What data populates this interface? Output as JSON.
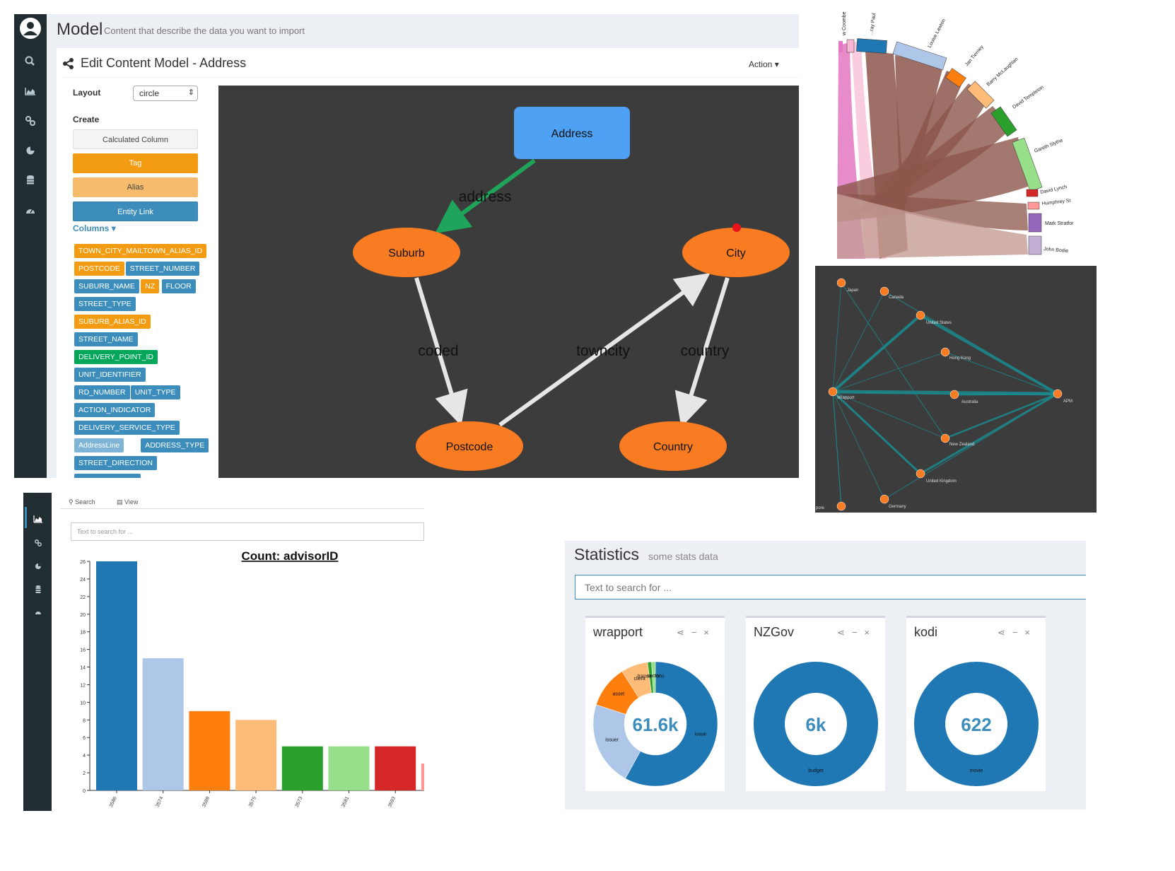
{
  "model_panel": {
    "title": "Model",
    "subtitle": "Content that describe the data you want to import",
    "box_title": "Edit Content Model - Address",
    "action_label": "Action",
    "layout_label": "Layout",
    "layout_value": "circle",
    "create_label": "Create",
    "buttons": {
      "calculated": "Calculated Column",
      "tag": "Tag",
      "alias": "Alias",
      "entity_link": "Entity Link"
    },
    "columns_label": "Columns",
    "columns": [
      {
        "label": "TOWN_CITY_MAILTOWN_ALIAS_ID",
        "color": "orange"
      },
      {
        "label": "POSTCODE",
        "color": "orange"
      },
      {
        "label": "STREET_NUMBER",
        "color": "blue"
      },
      {
        "label": "SUBURB_NAME",
        "color": "blue"
      },
      {
        "label": "NZ",
        "color": "orange"
      },
      {
        "label": "FLOOR",
        "color": "blue"
      },
      {
        "label": "STREET_TYPE",
        "color": "blue"
      },
      {
        "label": "SUBURB_ALIAS_ID",
        "color": "orange"
      },
      {
        "label": "STREET_NAME",
        "color": "blue"
      },
      {
        "label": "DELIVERY_POINT_ID",
        "color": "green"
      },
      {
        "label": "UNIT_IDENTIFIER",
        "color": "blue"
      },
      {
        "label": "RD_NUMBER",
        "color": "blue"
      },
      {
        "label": "UNIT_TYPE",
        "color": "blue"
      },
      {
        "label": "ACTION_INDICATOR",
        "color": "blue"
      },
      {
        "label": "DELIVERY_SERVICE_TYPE",
        "color": "blue"
      },
      {
        "label": "AddressLine",
        "color": "light"
      },
      {
        "label": "ADDRESS_TYPE",
        "color": "blue"
      },
      {
        "label": "STREET_DIRECTION",
        "color": "blue"
      }
    ],
    "graph": {
      "nodes": {
        "address": "Address",
        "suburb": "Suburb",
        "city": "City",
        "postcode": "Postcode",
        "country": "Country"
      },
      "edges": {
        "address": "address",
        "coded": "coded",
        "towncity": "towncity",
        "country": "country"
      }
    },
    "colors": {
      "sidebar": "#222d32",
      "node_orange": "#f97c22",
      "node_blue": "#4ea1f3",
      "edge_green": "#1fa55b"
    }
  },
  "chord_panel": {
    "labels": [
      "w Coombe",
      "...ray Paul",
      "Louise Lawton",
      "Jan Tierney",
      "Barry McLaughlan",
      "David Templeton",
      "Gareth Slythe",
      "David Lynch",
      "Humphrey St",
      "Mark Stratfor",
      "John Bodie"
    ]
  },
  "network_panel": {
    "nodes": [
      "Japan",
      "Canada",
      "United States",
      "Hong Kong",
      "Wrapport",
      "Australia",
      "APM",
      "New Zealand",
      "United Kingdom",
      "pore",
      "Germany"
    ]
  },
  "bar_panel": {
    "tabs": [
      "Search",
      "View"
    ],
    "search_placeholder": "Text to search for ..."
  },
  "chart_data": {
    "type": "bar",
    "title": "Count: advisorID",
    "categories": [
      "3586",
      "3574",
      "3589",
      "3575",
      "3573",
      "3581",
      "3593"
    ],
    "values": [
      26,
      15,
      9,
      8,
      5,
      5,
      5
    ],
    "colors": [
      "#1f77b4",
      "#aec7e8",
      "#ff7f0e",
      "#ffbb78",
      "#2ca02c",
      "#98df8a",
      "#d62728"
    ],
    "ylim": [
      0,
      26
    ],
    "yticks": [
      "0",
      "2",
      "4",
      "6",
      "8",
      "10",
      "12",
      "14",
      "16",
      "18",
      "20",
      "22",
      "24",
      "26"
    ]
  },
  "stats_panel": {
    "title": "Statistics",
    "subtitle": "some stats data",
    "search_placeholder": "Text to search for ...",
    "cards": [
      {
        "name": "wrapport",
        "total": "61.6k",
        "slices": [
          {
            "label": "issue",
            "value": 0.58
          },
          {
            "label": "issuer",
            "value": 0.22
          },
          {
            "label": "asset",
            "value": 0.11
          },
          {
            "label": "client",
            "value": 0.07
          },
          {
            "label": "transactions",
            "value": 0.01
          },
          {
            "label": "sector",
            "value": 0.01
          }
        ]
      },
      {
        "name": "NZGov",
        "total": "6k",
        "slices": [
          {
            "label": "budget",
            "value": 1.0
          }
        ]
      },
      {
        "name": "kodi",
        "total": "622",
        "slices": [
          {
            "label": "movie",
            "value": 1.0
          }
        ]
      }
    ]
  }
}
